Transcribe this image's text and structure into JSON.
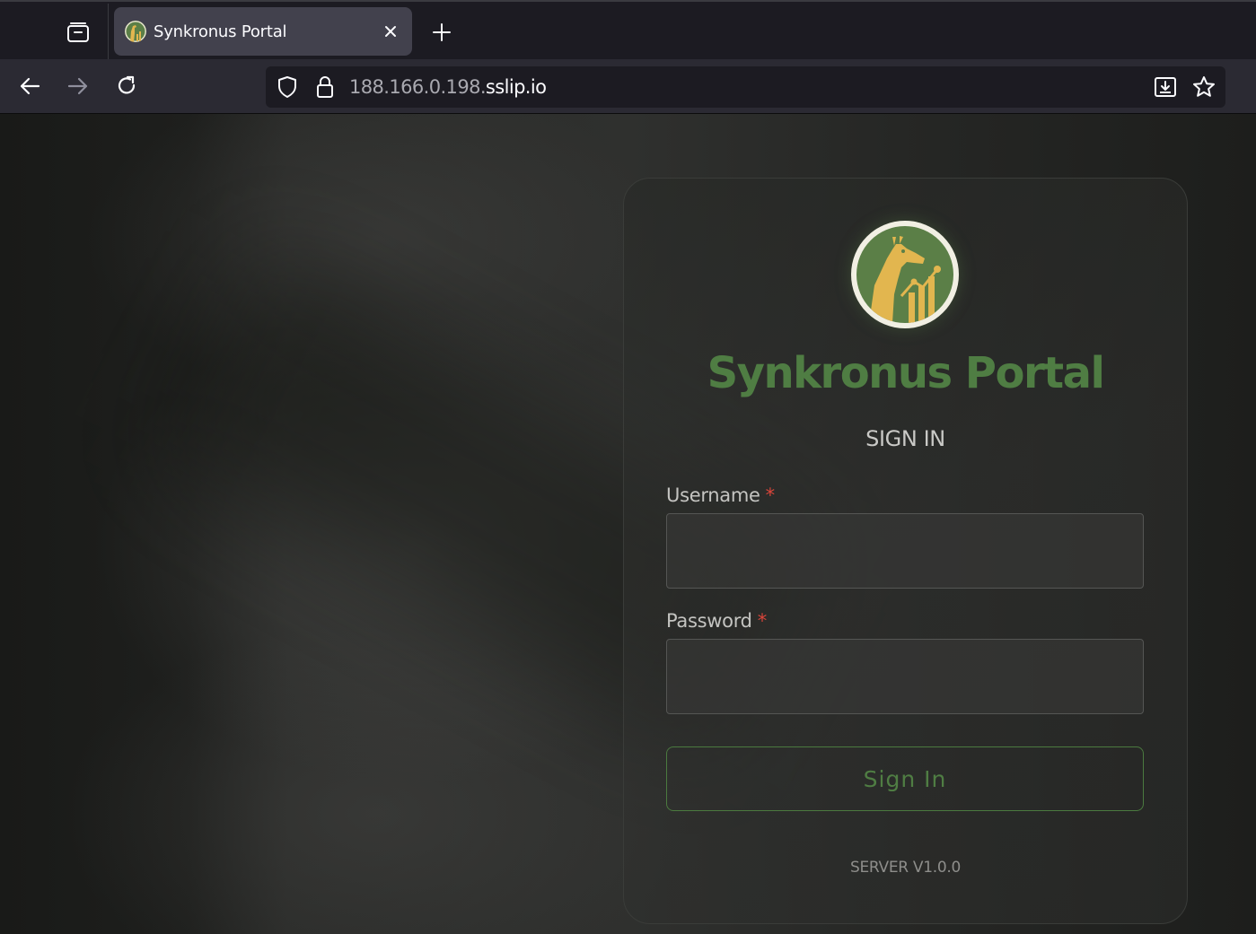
{
  "browser": {
    "tab": {
      "title": "Synkronus Portal",
      "favicon": "giraffe-logo-icon"
    },
    "icons": {
      "tab_list": "tab-list-icon",
      "close": "close-icon",
      "new_tab": "plus-icon",
      "back": "arrow-left-icon",
      "forward": "arrow-right-icon",
      "reload": "reload-icon",
      "tracking_protection": "shield-icon",
      "secure": "lock-icon",
      "save_to_pocket": "download-icon",
      "bookmark": "star-icon"
    },
    "url": {
      "host_dim": "188.166.0.198.",
      "host_main": "sslip.io"
    }
  },
  "login": {
    "logo": "giraffe-chart-logo",
    "title": "Synkronus Portal",
    "subtitle": "SIGN IN",
    "username_label": "Username",
    "username_value": "",
    "password_label": "Password",
    "password_value": "",
    "required_marker": "*",
    "submit_label": "Sign In",
    "version": "SERVER V1.0.0"
  },
  "colors": {
    "brand_green": "#4f7d43",
    "logo_bg": "#5b7f47",
    "logo_gold": "#e2b64f",
    "required_red": "#d9453a",
    "tab_active": "#42414d",
    "toolbar": "#2b2a33"
  }
}
